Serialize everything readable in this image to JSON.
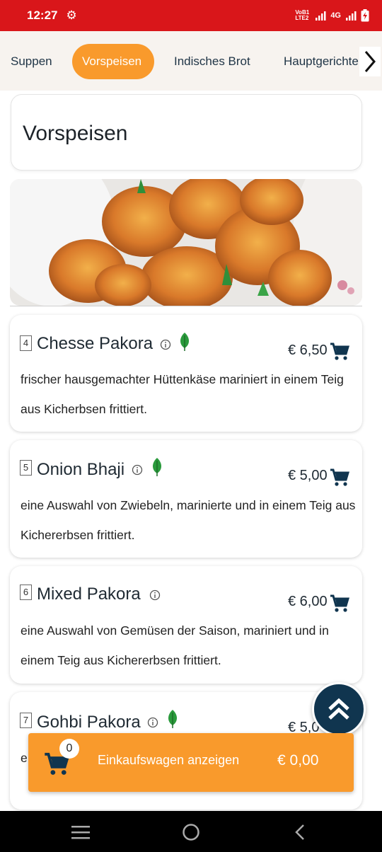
{
  "status": {
    "time": "12:27",
    "network_small": "VoB1 LTE2",
    "network": "4G"
  },
  "categories": [
    {
      "label": "Suppen",
      "active": false
    },
    {
      "label": "Vorspeisen",
      "active": true
    },
    {
      "label": "Indisches Brot",
      "active": false
    },
    {
      "label": "Hauptgerichte",
      "active": false
    }
  ],
  "section": {
    "title": "Vorspeisen"
  },
  "items": [
    {
      "number": "4",
      "name": "Chesse Pakora",
      "vegetarian": true,
      "price": "€ 6,50",
      "description": "frischer hausgemachter Hüttenkäse mariniert in einem Teig aus Kicherbsen frittiert."
    },
    {
      "number": "5",
      "name": "Onion Bhaji",
      "vegetarian": true,
      "price": "€ 5,00",
      "description": "eine Auswahl von Zwiebeln, marinierte und in einem Teig aus Kichererbsen frittiert."
    },
    {
      "number": "6",
      "name": "Mixed Pakora",
      "vegetarian": false,
      "price": "€ 6,00",
      "description": "eine Auswahl von Gemüsen der Saison, mariniert und in einem Teig aus Kichererbsen frittiert."
    },
    {
      "number": "7",
      "name": "Gohbi Pakora",
      "vegetarian": true,
      "price": "€ 5,0",
      "description": "e"
    }
  ],
  "cart": {
    "count": "0",
    "label": "Einkaufswagen anzeigen",
    "total": "€ 0,00"
  },
  "colors": {
    "status_bar": "#d9161a",
    "accent": "#f99a2c",
    "navy": "#10354f",
    "veg_green": "#2a9a3c"
  },
  "icons": {
    "info": "info-icon",
    "veg": "leaf-icon",
    "add_to_cart": "cart-icon",
    "scroll_top": "double-chevron-up-icon"
  }
}
